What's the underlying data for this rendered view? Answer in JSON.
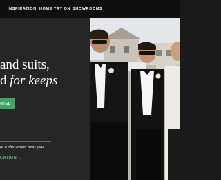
{
  "nav": {
    "items": [
      {
        "label": "INSPIRATION"
      },
      {
        "label": "HOME TRY ON"
      },
      {
        "label": "SHOWROOMS"
      }
    ]
  },
  "hero": {
    "headline_line1": "and suits,",
    "headline_line2_plain": "d ",
    "headline_line2_italic": "for keeps",
    "cta_label": "ARTED",
    "locate_text": "at a showroom near you",
    "locate_link": "CATION →"
  },
  "colors": {
    "accent": "#3fa464",
    "link": "#4cc07a",
    "background": "#262626"
  }
}
